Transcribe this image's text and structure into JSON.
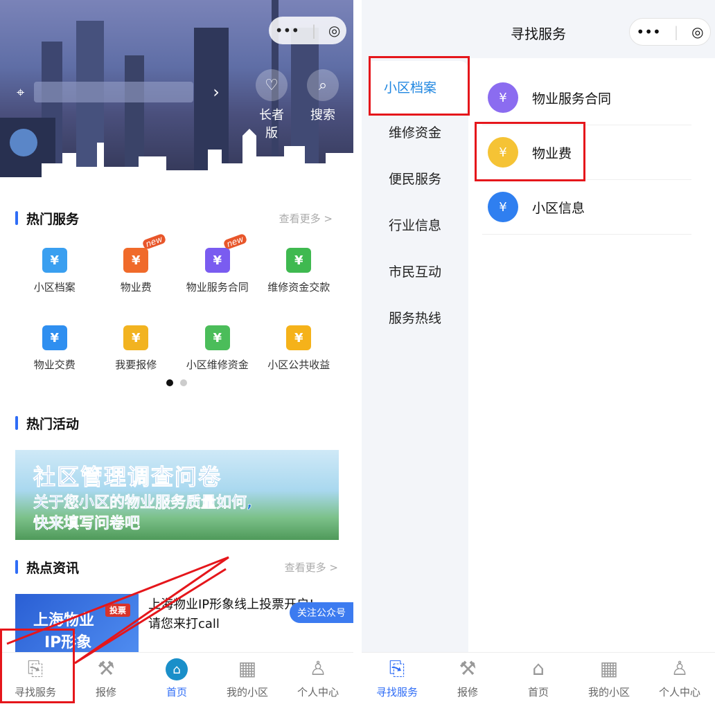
{
  "left": {
    "banner": {
      "capsule_more": "•••",
      "capsule_close": "◎",
      "btn_elder": "长者版",
      "btn_search": "搜索"
    },
    "hot_services": {
      "title": "热门服务",
      "more": "查看更多 >",
      "items": [
        {
          "label": "小区档案",
          "icon": "building-icon",
          "color": "#3a9ff0",
          "badge": ""
        },
        {
          "label": "物业费",
          "icon": "house-yen-icon",
          "color": "#f06a2a",
          "badge": "new"
        },
        {
          "label": "物业服务合同",
          "icon": "contract-icon",
          "color": "#7a5cf0",
          "badge": "new"
        },
        {
          "label": "维修资金交款",
          "icon": "yen-box-icon",
          "color": "#3fb950",
          "badge": ""
        },
        {
          "label": "物业交费",
          "icon": "hand-yen-icon",
          "color": "#2f8ff0",
          "badge": ""
        },
        {
          "label": "我要报修",
          "icon": "tools-icon",
          "color": "#f2b320",
          "badge": ""
        },
        {
          "label": "小区维修资金",
          "icon": "wallet-icon",
          "color": "#4bbd5a",
          "badge": ""
        },
        {
          "label": "小区公共收益",
          "icon": "purse-yen-icon",
          "color": "#f5b21a",
          "badge": ""
        }
      ]
    },
    "hot_activity": {
      "title": "热门活动",
      "banner_title": "社区管理调查问卷",
      "banner_line1": "关于您小区的物业服务质量如何,",
      "banner_line2": "快来填写问卷吧"
    },
    "hot_news": {
      "title": "热点资讯",
      "more": "查看更多 >",
      "img_text_line1": "上海物业",
      "img_text_line2": "IP形象",
      "img_tag": "投票",
      "headline_line1": "上海物业IP形象线上投票开启!",
      "headline_line2": "请您来打call",
      "follow": "关注公众号"
    },
    "tabs": [
      {
        "label": "寻找服务",
        "icon": "find-service-icon"
      },
      {
        "label": "报修",
        "icon": "repair-icon"
      },
      {
        "label": "首页",
        "icon": "home-icon"
      },
      {
        "label": "我的小区",
        "icon": "my-community-icon"
      },
      {
        "label": "个人中心",
        "icon": "user-icon"
      }
    ],
    "active_tab": "首页"
  },
  "right": {
    "title": "寻找服务",
    "capsule_more": "•••",
    "capsule_close": "◎",
    "nav": [
      "小区档案",
      "维修资金",
      "便民服务",
      "行业信息",
      "市民互动",
      "服务热线"
    ],
    "selected_nav": "小区档案",
    "items": [
      {
        "label": "物业服务合同",
        "icon": "contract-icon",
        "color": "#8b6cf0"
      },
      {
        "label": "物业费",
        "icon": "house-yen-icon",
        "color": "#f5c335"
      },
      {
        "label": "小区信息",
        "icon": "building-icon",
        "color": "#2f7ff0"
      }
    ],
    "tabs": [
      {
        "label": "寻找服务",
        "icon": "find-service-icon"
      },
      {
        "label": "报修",
        "icon": "repair-icon"
      },
      {
        "label": "首页",
        "icon": "home-icon"
      },
      {
        "label": "我的小区",
        "icon": "my-community-icon"
      },
      {
        "label": "个人中心",
        "icon": "user-icon"
      }
    ],
    "active_tab": "寻找服务"
  },
  "annotation_color": "#e5161b"
}
